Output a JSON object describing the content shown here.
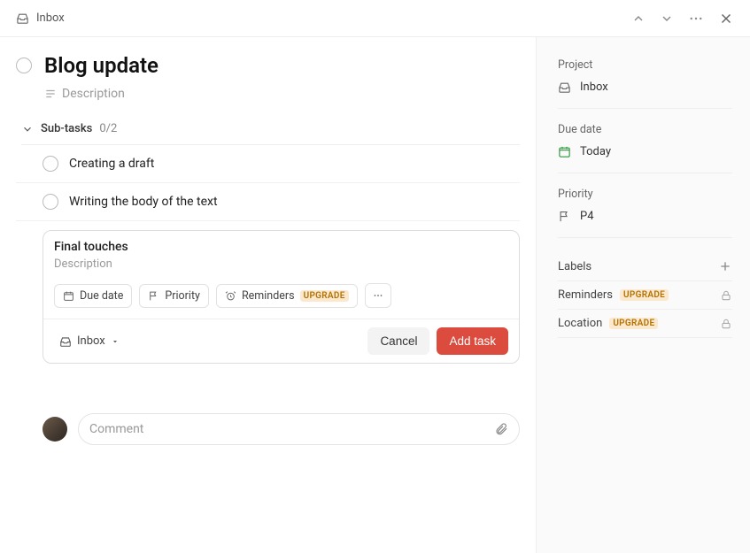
{
  "topbar": {
    "location": "Inbox"
  },
  "task": {
    "title": "Blog update",
    "description_placeholder": "Description"
  },
  "subtasks": {
    "label": "Sub-tasks",
    "count": "0/2",
    "items": [
      {
        "title": "Creating a draft"
      },
      {
        "title": "Writing the body of the text"
      }
    ]
  },
  "new_task": {
    "title": "Final touches",
    "description_placeholder": "Description",
    "chips": {
      "due_date": "Due date",
      "priority": "Priority",
      "reminders": "Reminders",
      "upgrade": "UPGRADE"
    },
    "project_selector": "Inbox",
    "cancel": "Cancel",
    "add": "Add task"
  },
  "comment": {
    "placeholder": "Comment"
  },
  "sidebar": {
    "project": {
      "label": "Project",
      "value": "Inbox"
    },
    "due_date": {
      "label": "Due date",
      "value": "Today"
    },
    "priority": {
      "label": "Priority",
      "value": "P4"
    },
    "labels": {
      "label": "Labels"
    },
    "reminders": {
      "label": "Reminders",
      "badge": "UPGRADE"
    },
    "location": {
      "label": "Location",
      "badge": "UPGRADE"
    }
  }
}
